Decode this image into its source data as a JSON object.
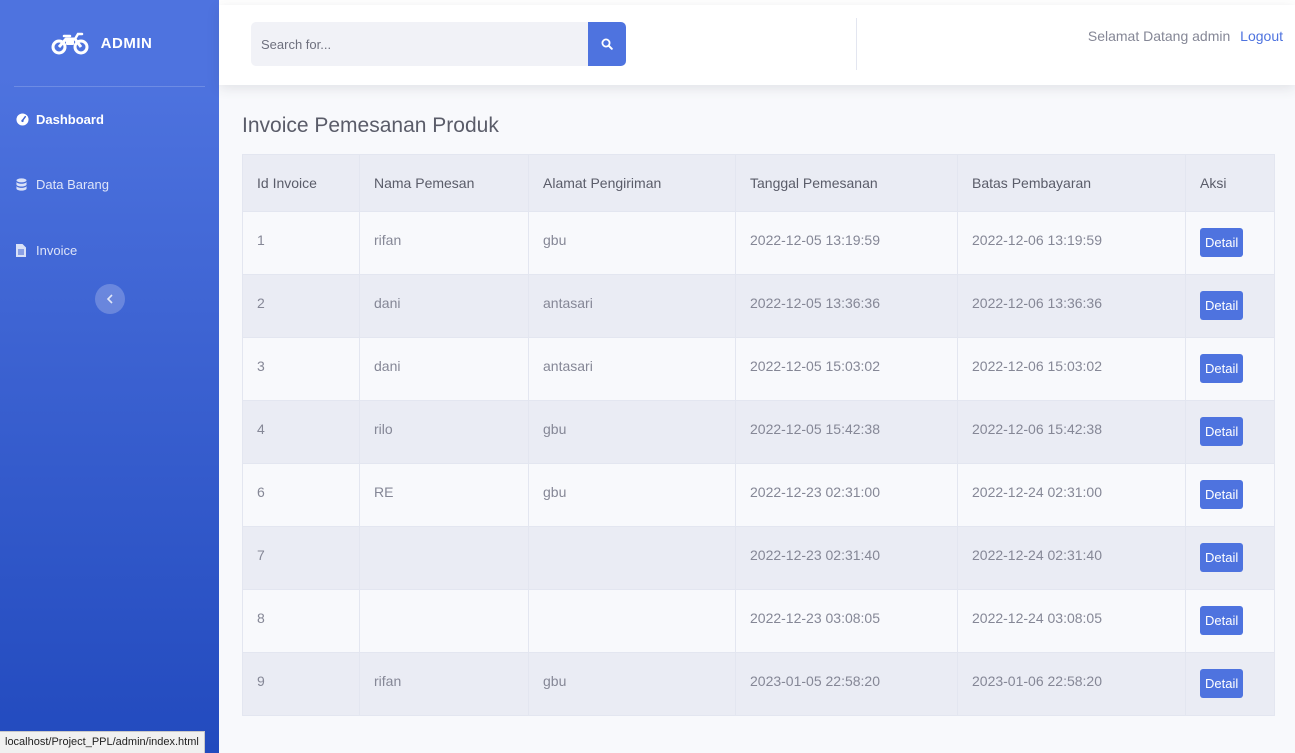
{
  "sidebar": {
    "brand": "ADMIN",
    "brand_icon": "motorcycle-icon",
    "items": [
      {
        "label": "Dashboard",
        "icon": "tachometer-icon",
        "active": true
      },
      {
        "label": "Data Barang",
        "icon": "database-icon",
        "active": false
      },
      {
        "label": "Invoice",
        "icon": "file-icon",
        "active": false
      }
    ],
    "toggle_icon": "chevron-left-icon"
  },
  "topbar": {
    "search_placeholder": "Search for...",
    "search_icon": "search-icon",
    "welcome": "Selamat Datang admin",
    "logout": "Logout"
  },
  "page": {
    "title": "Invoice Pemesanan Produk"
  },
  "table": {
    "headers": [
      "Id Invoice",
      "Nama Pemesan",
      "Alamat Pengiriman",
      "Tanggal Pemesanan",
      "Batas Pembayaran",
      "Aksi"
    ],
    "action_label": "Detail",
    "rows": [
      {
        "id": "1",
        "nama": "rifan",
        "alamat": "gbu",
        "tanggal": "2022-12-05 13:19:59",
        "batas": "2022-12-06 13:19:59"
      },
      {
        "id": "2",
        "nama": "dani",
        "alamat": "antasari",
        "tanggal": "2022-12-05 13:36:36",
        "batas": "2022-12-06 13:36:36"
      },
      {
        "id": "3",
        "nama": "dani",
        "alamat": "antasari",
        "tanggal": "2022-12-05 15:03:02",
        "batas": "2022-12-06 15:03:02"
      },
      {
        "id": "4",
        "nama": "rilo",
        "alamat": "gbu",
        "tanggal": "2022-12-05 15:42:38",
        "batas": "2022-12-06 15:42:38"
      },
      {
        "id": "6",
        "nama": "RE",
        "alamat": "gbu",
        "tanggal": "2022-12-23 02:31:00",
        "batas": "2022-12-24 02:31:00"
      },
      {
        "id": "7",
        "nama": "",
        "alamat": "",
        "tanggal": "2022-12-23 02:31:40",
        "batas": "2022-12-24 02:31:40"
      },
      {
        "id": "8",
        "nama": "",
        "alamat": "",
        "tanggal": "2022-12-23 03:08:05",
        "batas": "2022-12-24 03:08:05"
      },
      {
        "id": "9",
        "nama": "rifan",
        "alamat": "gbu",
        "tanggal": "2023-01-05 22:58:20",
        "batas": "2023-01-06 22:58:20"
      }
    ]
  },
  "status_bar": {
    "url": "localhost/Project_PPL/admin/index.html"
  },
  "colors": {
    "primary": "#4e73df",
    "sidebar_bottom": "#224abe",
    "text": "#5a5c69",
    "muted": "#858796"
  }
}
